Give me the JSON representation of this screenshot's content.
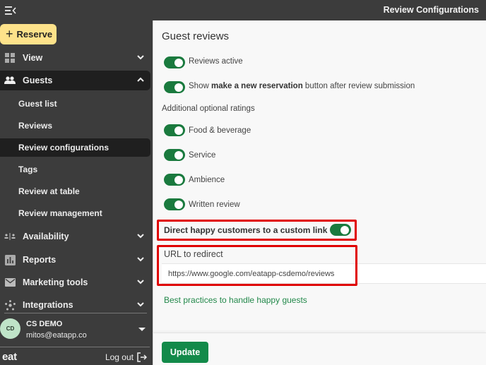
{
  "sidebar": {
    "collapse_icon": "menu-collapse-icon",
    "reserve_label": "Reserve",
    "items": [
      {
        "label": "View",
        "icon": "grid-icon",
        "expanded": false
      },
      {
        "label": "Guests",
        "icon": "people-icon",
        "expanded": true
      },
      {
        "label": "Availability",
        "icon": "availability-icon",
        "expanded": false
      },
      {
        "label": "Reports",
        "icon": "bar-chart-icon",
        "expanded": false
      },
      {
        "label": "Marketing tools",
        "icon": "mail-icon",
        "expanded": false
      },
      {
        "label": "Integrations",
        "icon": "integrations-icon",
        "expanded": false
      }
    ],
    "guests_subitems": [
      {
        "label": "Guest list"
      },
      {
        "label": "Reviews"
      },
      {
        "label": "Review configurations",
        "selected": true
      },
      {
        "label": "Tags"
      },
      {
        "label": "Review at table"
      },
      {
        "label": "Review management"
      }
    ],
    "user": {
      "initials": "CD",
      "name": "CS DEMO",
      "email": "mitos@eatapp.co"
    },
    "logo": "eat",
    "logout_label": "Log out"
  },
  "header": {
    "title": "Review Configurations"
  },
  "main": {
    "section_title": "Guest reviews",
    "reviews_active_label": "Reviews active",
    "reviews_active": true,
    "show_button_pre": "Show ",
    "show_button_bold": "make a new reservation",
    "show_button_post": " button after review submission",
    "show_button_enabled": true,
    "additional_heading": "Additional optional ratings",
    "ratings": [
      {
        "label": "Food & beverage",
        "enabled": true
      },
      {
        "label": "Service",
        "enabled": true
      },
      {
        "label": "Ambience",
        "enabled": true
      },
      {
        "label": "Written review",
        "enabled": true
      }
    ],
    "direct_happy_label": "Direct happy customers to a custom link",
    "direct_happy_enabled": true,
    "url_label": "URL to redirect",
    "url_value": "https://www.google.com/eatapp-csdemo/reviews",
    "best_practices_link": "Best practices to handle happy guests"
  },
  "footer": {
    "update_label": "Update"
  },
  "colors": {
    "sidebar_bg": "#3c3c3c",
    "toggle_on": "#1a7a3e",
    "primary_button": "#138a4a",
    "reserve_button": "#fde28a",
    "highlight": "#e00000",
    "link": "#22884a"
  }
}
